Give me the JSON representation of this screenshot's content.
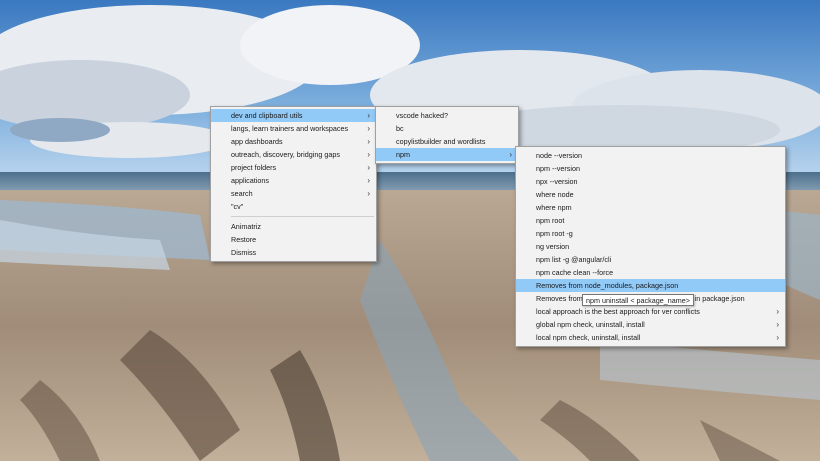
{
  "menu1": {
    "items": [
      {
        "label": "dev and clipboard utils",
        "arrow": "›"
      },
      {
        "label": "langs, learn trainers and workspaces",
        "arrow": "›"
      },
      {
        "label": "app dashboards",
        "arrow": "›"
      },
      {
        "label": "outreach, discovery, bridging gaps",
        "arrow": "›"
      },
      {
        "label": "project folders",
        "arrow": "›"
      },
      {
        "label": "applications",
        "arrow": "›"
      },
      {
        "label": "search",
        "arrow": "›"
      },
      {
        "label": "\"cv\""
      }
    ],
    "footer": [
      "Animatriz",
      "Restore",
      "Dismiss"
    ]
  },
  "menu2": {
    "items": [
      {
        "label": "vscode hacked?"
      },
      {
        "label": "bc"
      },
      {
        "label": "copylistbuilder and wordlists"
      },
      {
        "label": "npm",
        "arrow": "›"
      }
    ]
  },
  "menu3": {
    "items": [
      {
        "label": "node --version"
      },
      {
        "label": "npm --version"
      },
      {
        "label": "npx --version"
      },
      {
        "label": "where node"
      },
      {
        "label": "where npm"
      },
      {
        "label": "npm root"
      },
      {
        "label": "npm root -g"
      },
      {
        "label": "ng version"
      },
      {
        "label": "npm list -g @angular/cli"
      },
      {
        "label": "npm cache clean --force"
      },
      {
        "label": "Removes from node_modules, package.json"
      },
      {
        "label": "Removes from node_modules and dependencies in package.json"
      },
      {
        "label": "local approach is the best approach for ver conflicts",
        "arrow": "›"
      },
      {
        "label": "global npm check, uninstall, install",
        "arrow": "›"
      },
      {
        "label": "local npm check, uninstall, install",
        "arrow": "›"
      }
    ]
  },
  "tooltip": {
    "text": "npm uninstall < package_name>"
  },
  "colors": {
    "highlight": "#91c9f7",
    "menu_bg": "#f2f2f2"
  }
}
